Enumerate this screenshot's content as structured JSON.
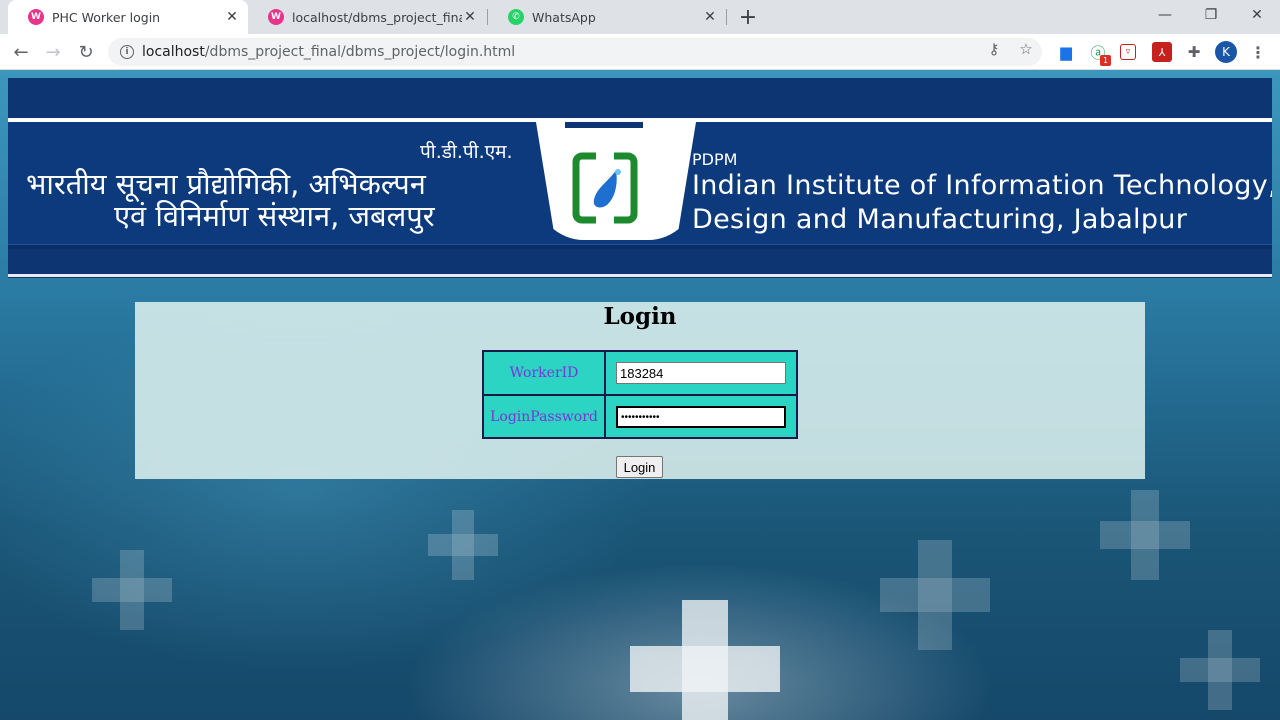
{
  "browser": {
    "tabs": [
      {
        "title": "PHC Worker login",
        "favicon": "app-icon",
        "favicon_color": "#e8348b",
        "active": true
      },
      {
        "title": "localhost/dbms_project_final/Dat",
        "favicon": "app-icon",
        "favicon_color": "#e8348b",
        "active": false
      },
      {
        "title": "WhatsApp",
        "favicon": "whatsapp-icon",
        "favicon_color": "#25d366",
        "active": false
      }
    ],
    "url_host": "localhost",
    "url_path": "/dbms_project_final/dbms_project/login.html",
    "profile_initial": "K",
    "extension_badge": "1"
  },
  "banner": {
    "hindi_abbr": "पी.डी.पी.एम.",
    "hindi_line1": "भारतीय सूचना प्रौद्योगिकी, अभिकल्पन",
    "hindi_line2": "एवं विनिर्माण संस्थान, जबलपुर",
    "english_abbr": "PDPM",
    "english_line1": "Indian Institute of Information Technology,",
    "english_line2": "Design and Manufacturing, Jabalpur"
  },
  "login": {
    "title": "Login",
    "worker_id_label": "WorkerID",
    "worker_id_value": "183284",
    "password_label": "LoginPassword",
    "password_mask": "•••••••••••",
    "submit_label": "Login"
  },
  "colors": {
    "banner_bg": "#0d3572",
    "table_bg": "#2cd4c4",
    "label_color": "#7a35d8"
  }
}
